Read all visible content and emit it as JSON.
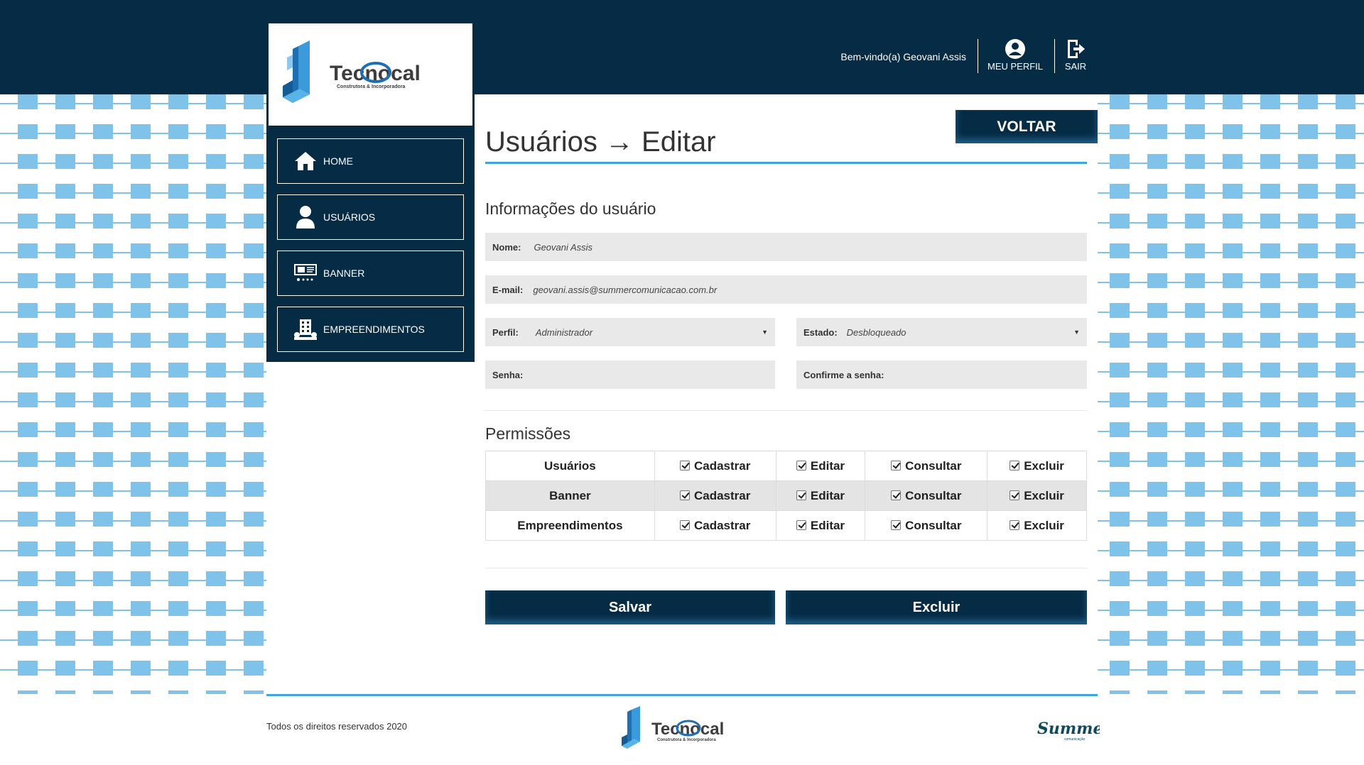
{
  "header": {
    "welcome": "Bem-vindo(a) Geovani Assis",
    "profile_label": "MEU PERFIL",
    "logout_label": "SAIR",
    "icons": [
      "user-circle-icon",
      "logout-icon"
    ]
  },
  "logo": {
    "name": "Tecnocal",
    "tagline": "Construtora & Incorporadora"
  },
  "sidebar": {
    "items": [
      {
        "label": "HOME",
        "icon": "home-icon"
      },
      {
        "label": "USUÁRIOS",
        "icon": "user-icon"
      },
      {
        "label": "BANNER",
        "icon": "banner-icon"
      },
      {
        "label": "EMPREENDIMENTOS",
        "icon": "building-icon"
      }
    ]
  },
  "page": {
    "title": "Usuários → Editar",
    "back_label": "VOLTAR"
  },
  "user_info": {
    "section_title": "Informações do usuário",
    "name_label": "Nome:",
    "name_value": "Geovani Assis",
    "email_label": "E-mail:",
    "email_value": "geovani.assis@summercomunicacao.com.br",
    "perfil_label": "Perfil:",
    "perfil_value": "Administrador",
    "estado_label": "Estado:",
    "estado_value": "Desbloqueado",
    "senha_label": "Senha:",
    "confirm_label": "Confirme a senha:"
  },
  "permissions": {
    "section_title": "Permissões",
    "actions": [
      "Cadastrar",
      "Editar",
      "Consultar",
      "Excluir"
    ],
    "rows": [
      {
        "name": "Usuários",
        "checked": [
          true,
          true,
          true,
          true
        ]
      },
      {
        "name": "Banner",
        "checked": [
          true,
          true,
          true,
          true
        ]
      },
      {
        "name": "Empreendimentos",
        "checked": [
          true,
          true,
          true,
          true
        ]
      }
    ]
  },
  "actions": {
    "save_label": "Salvar",
    "delete_label": "Excluir"
  },
  "footer": {
    "copyright": "Todos os direitos reservados 2020",
    "agency": "Summer",
    "agency_tag": "comunicação"
  },
  "colors": {
    "navy": "#062b45",
    "accent": "#3fa3dc",
    "field_bg": "#e9e9e9"
  }
}
